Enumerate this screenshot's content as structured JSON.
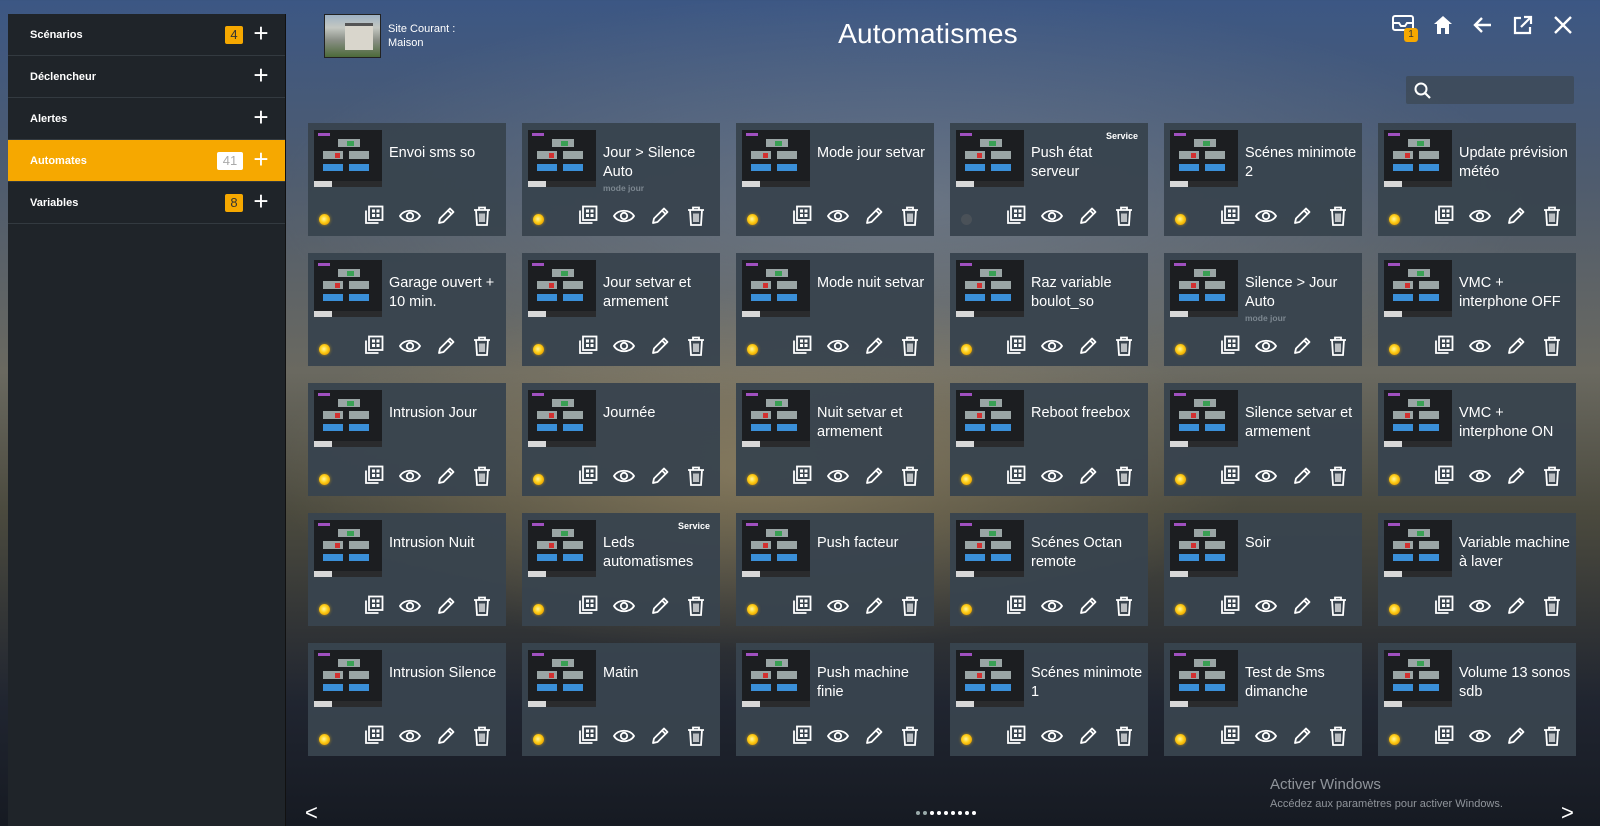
{
  "sidebar": {
    "items": [
      {
        "label": "Scénarios",
        "badge": "4",
        "active": false
      },
      {
        "label": "Déclencheur",
        "badge": "",
        "active": false
      },
      {
        "label": "Alertes",
        "badge": "",
        "active": false
      },
      {
        "label": "Automates",
        "badge": "41",
        "active": true
      },
      {
        "label": "Variables",
        "badge": "8",
        "active": false
      }
    ],
    "plus_label": "+"
  },
  "header": {
    "site_label": "Site Courant :",
    "site_name": "Maison",
    "title": "Automatismes",
    "notification_count": "1",
    "icons": [
      "inbox-icon",
      "home-icon",
      "back-arrow-icon",
      "external-link-icon",
      "close-icon"
    ]
  },
  "search": {
    "placeholder": "",
    "value": ""
  },
  "colors": {
    "accent": "#f6a800",
    "card_bg": "#38444e",
    "status_on": "#ffd21c",
    "status_off": "#4a5158"
  },
  "automatismes": [
    {
      "name": "Envoi sms so",
      "subtitle": "",
      "badge": "",
      "status": "on"
    },
    {
      "name": "Jour > Silence Auto",
      "subtitle": "mode jour",
      "badge": "",
      "status": "on"
    },
    {
      "name": "Mode jour setvar",
      "subtitle": "",
      "badge": "",
      "status": "on"
    },
    {
      "name": "Push état serveur",
      "subtitle": "",
      "badge": "Service",
      "status": "off"
    },
    {
      "name": "Scénes minimote 2",
      "subtitle": "",
      "badge": "",
      "status": "on"
    },
    {
      "name": "Update prévision météo",
      "subtitle": "",
      "badge": "",
      "status": "on"
    },
    {
      "name": "Garage ouvert + 10 min.",
      "subtitle": "",
      "badge": "",
      "status": "on"
    },
    {
      "name": "Jour setvar et armement",
      "subtitle": "",
      "badge": "",
      "status": "on"
    },
    {
      "name": "Mode nuit setvar",
      "subtitle": "",
      "badge": "",
      "status": "on"
    },
    {
      "name": "Raz variable boulot_so",
      "subtitle": "",
      "badge": "",
      "status": "on"
    },
    {
      "name": "Silence > Jour Auto",
      "subtitle": "mode jour",
      "badge": "",
      "status": "on"
    },
    {
      "name": "VMC + interphone OFF",
      "subtitle": "",
      "badge": "",
      "status": "on"
    },
    {
      "name": "Intrusion Jour",
      "subtitle": "",
      "badge": "",
      "status": "on"
    },
    {
      "name": "Journée",
      "subtitle": "",
      "badge": "",
      "status": "on"
    },
    {
      "name": "Nuit setvar et armement",
      "subtitle": "",
      "badge": "",
      "status": "on"
    },
    {
      "name": "Reboot freebox",
      "subtitle": "",
      "badge": "",
      "status": "on"
    },
    {
      "name": "Silence setvar et armement",
      "subtitle": "",
      "badge": "",
      "status": "on"
    },
    {
      "name": "VMC + interphone ON",
      "subtitle": "",
      "badge": "",
      "status": "on"
    },
    {
      "name": "Intrusion Nuit",
      "subtitle": "",
      "badge": "",
      "status": "on"
    },
    {
      "name": "Leds automatismes",
      "subtitle": "",
      "badge": "Service",
      "status": "on"
    },
    {
      "name": "Push facteur",
      "subtitle": "",
      "badge": "",
      "status": "on"
    },
    {
      "name": "Scénes Octan remote",
      "subtitle": "",
      "badge": "",
      "status": "on"
    },
    {
      "name": "Soir",
      "subtitle": "",
      "badge": "",
      "status": "on"
    },
    {
      "name": "Variable machine à laver",
      "subtitle": "",
      "badge": "",
      "status": "on"
    },
    {
      "name": "Intrusion Silence",
      "subtitle": "",
      "badge": "",
      "status": "on"
    },
    {
      "name": "Matin",
      "subtitle": "",
      "badge": "",
      "status": "on"
    },
    {
      "name": "Push machine finie",
      "subtitle": "",
      "badge": "",
      "status": "on"
    },
    {
      "name": "Scénes minimote 1",
      "subtitle": "",
      "badge": "",
      "status": "on"
    },
    {
      "name": "Test de Sms dimanche",
      "subtitle": "",
      "badge": "",
      "status": "on"
    },
    {
      "name": "Volume 13 sonos sdb",
      "subtitle": "",
      "badge": "",
      "status": "on"
    }
  ],
  "card_actions": [
    "duplicate-icon",
    "view-icon",
    "edit-icon",
    "delete-icon"
  ],
  "pagination": {
    "prev": "<",
    "next": ">",
    "pages": 9,
    "current": 3
  },
  "windows_watermark": {
    "title": "Activer Windows",
    "subtitle": "Accédez aux paramètres pour activer Windows."
  }
}
